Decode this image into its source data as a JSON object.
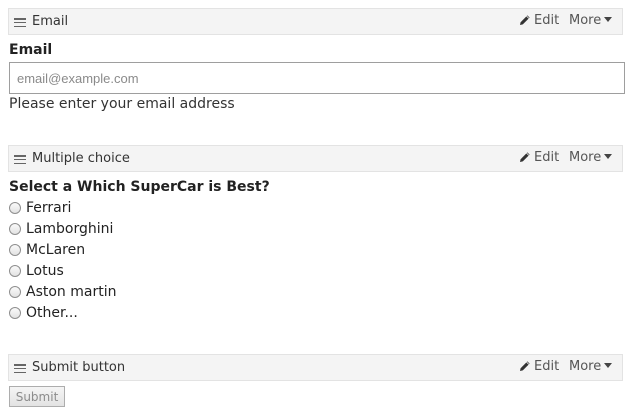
{
  "blocks": [
    {
      "title": "Email",
      "edit_label": "Edit",
      "more_label": "More"
    },
    {
      "title": "Multiple choice",
      "edit_label": "Edit",
      "more_label": "More"
    },
    {
      "title": "Submit button",
      "edit_label": "Edit",
      "more_label": "More"
    }
  ],
  "email_field": {
    "label": "Email",
    "value": "",
    "placeholder": "email@example.com",
    "help": "Please enter your email address"
  },
  "multiple_choice": {
    "question": "Select a Which SuperCar is Best?",
    "options": [
      "Ferrari",
      "Lamborghini",
      "McLaren",
      "Lotus",
      "Aston martin",
      "Other..."
    ]
  },
  "submit": {
    "label": "Submit"
  },
  "icons": {
    "drag": "hamburger-icon",
    "edit": "pencil-icon",
    "more": "caret-down-icon"
  },
  "colors": {
    "header_bg": "#f4f4f4",
    "header_border": "#e3e3e3",
    "text": "#222222"
  }
}
